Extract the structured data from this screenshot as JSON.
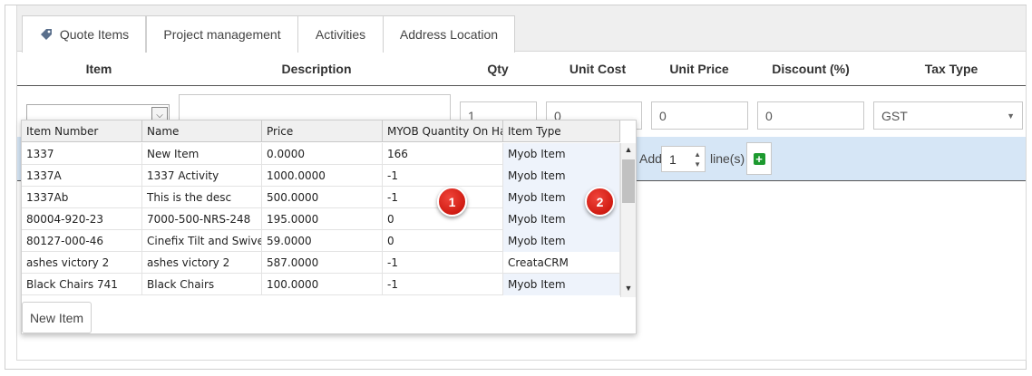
{
  "tabs": [
    {
      "label": "Quote Items",
      "icon": "tag-icon"
    },
    {
      "label": "Project management"
    },
    {
      "label": "Activities"
    },
    {
      "label": "Address Location"
    }
  ],
  "columns": {
    "item": "Item",
    "description": "Description",
    "qty": "Qty",
    "unit_cost": "Unit Cost",
    "unit_price": "Unit Price",
    "discount": "Discount (%)",
    "tax_type": "Tax Type"
  },
  "form": {
    "qty": "1",
    "unit_cost": "0",
    "unit_price": "0",
    "discount": "0",
    "tax_type": "GST"
  },
  "add_lines": {
    "add_label": "Add",
    "count": "1",
    "lines_label": "line(s)"
  },
  "grid": {
    "headers": [
      "Item Number",
      "Name",
      "Price",
      "MYOB Quantity On Hand",
      "Item Type"
    ],
    "rows": [
      [
        "1337",
        "New Item",
        "0.0000",
        "166",
        "Myob Item"
      ],
      [
        "1337A",
        "1337 Activity",
        "1000.0000",
        "-1",
        "Myob Item"
      ],
      [
        "1337Ab",
        "This is the desc",
        "500.0000",
        "-1",
        "Myob Item"
      ],
      [
        "80004-920-23",
        "7000-500-NRS-248",
        "195.0000",
        "0",
        "Myob Item"
      ],
      [
        "80127-000-46",
        "Cinefix Tilt and Swivel",
        "59.0000",
        "0",
        "Myob Item"
      ],
      [
        "ashes victory 2",
        "ashes victory 2",
        "587.0000",
        "-1",
        "CreataCRM"
      ],
      [
        "Black Chairs 741",
        "Black Chairs",
        "100.0000",
        "-1",
        "Myob Item"
      ]
    ]
  },
  "new_item_label": "New Item",
  "badges": [
    "1",
    "2"
  ],
  "colors": {
    "badge": "#d01b12",
    "plus": "#1d9a2f",
    "row_highlight": "#d6e6f6"
  }
}
